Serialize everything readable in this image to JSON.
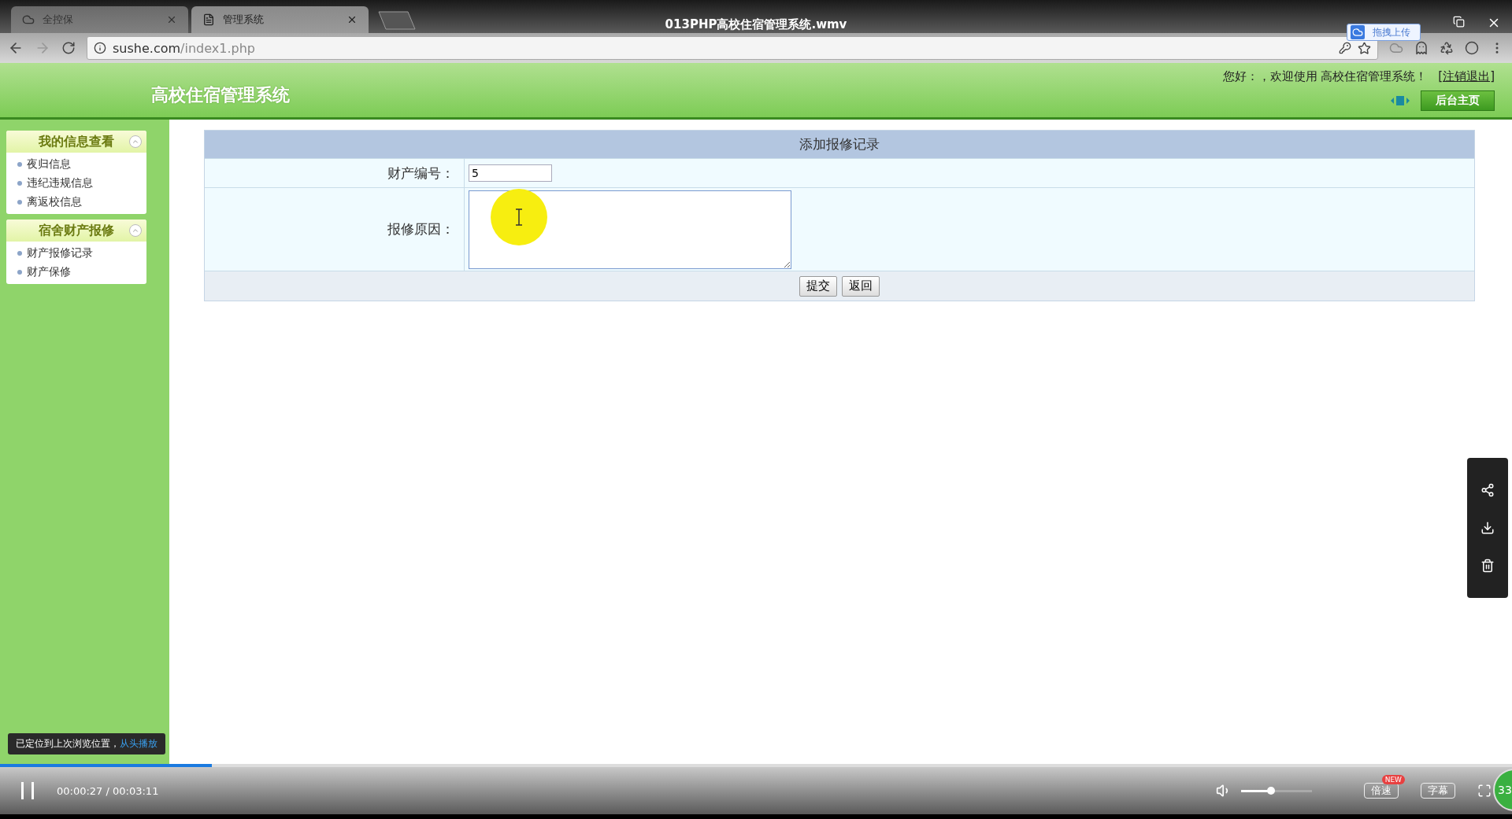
{
  "player": {
    "title": "013PHP高校住宿管理系统.wmv",
    "upload_button": "拖拽上传",
    "notice": {
      "text": "已定位到上次浏览位置，",
      "link": "从头播放"
    },
    "progress": {
      "level": 0.14
    },
    "time": "00:00:27 / 00:03:11",
    "volume": {
      "level": 0.42
    },
    "buttons": [
      {
        "label": "倍速",
        "badge": "NEW"
      },
      {
        "label": "字幕"
      }
    ],
    "counter": "33"
  },
  "browser": {
    "tabs": [
      {
        "label": "全控保",
        "selected": false
      },
      {
        "label": "管理系统",
        "selected": true
      }
    ],
    "url_host": "sushe.com",
    "url_path": "/index1.php"
  },
  "site": {
    "title": "高校住宿管理系统",
    "greeting": "您好：，欢迎使用 高校住宿管理系统！",
    "logout": "[注销退出]",
    "home_button": "后台主页"
  },
  "sidebar": [
    {
      "title": "我的信息查看",
      "expanded": true,
      "items": [
        "夜归信息",
        "违纪违规信息",
        "离返校信息"
      ]
    },
    {
      "title": "宿舍财产报修",
      "expanded": true,
      "items": [
        "财产报修记录",
        "财产保修"
      ]
    }
  ],
  "form": {
    "title": "添加报修记录",
    "fields": [
      {
        "label": "财产编号：",
        "kind": "input",
        "value": "5"
      },
      {
        "label": "报修原因：",
        "kind": "textarea"
      }
    ],
    "buttons": [
      "提交",
      "返回"
    ]
  }
}
